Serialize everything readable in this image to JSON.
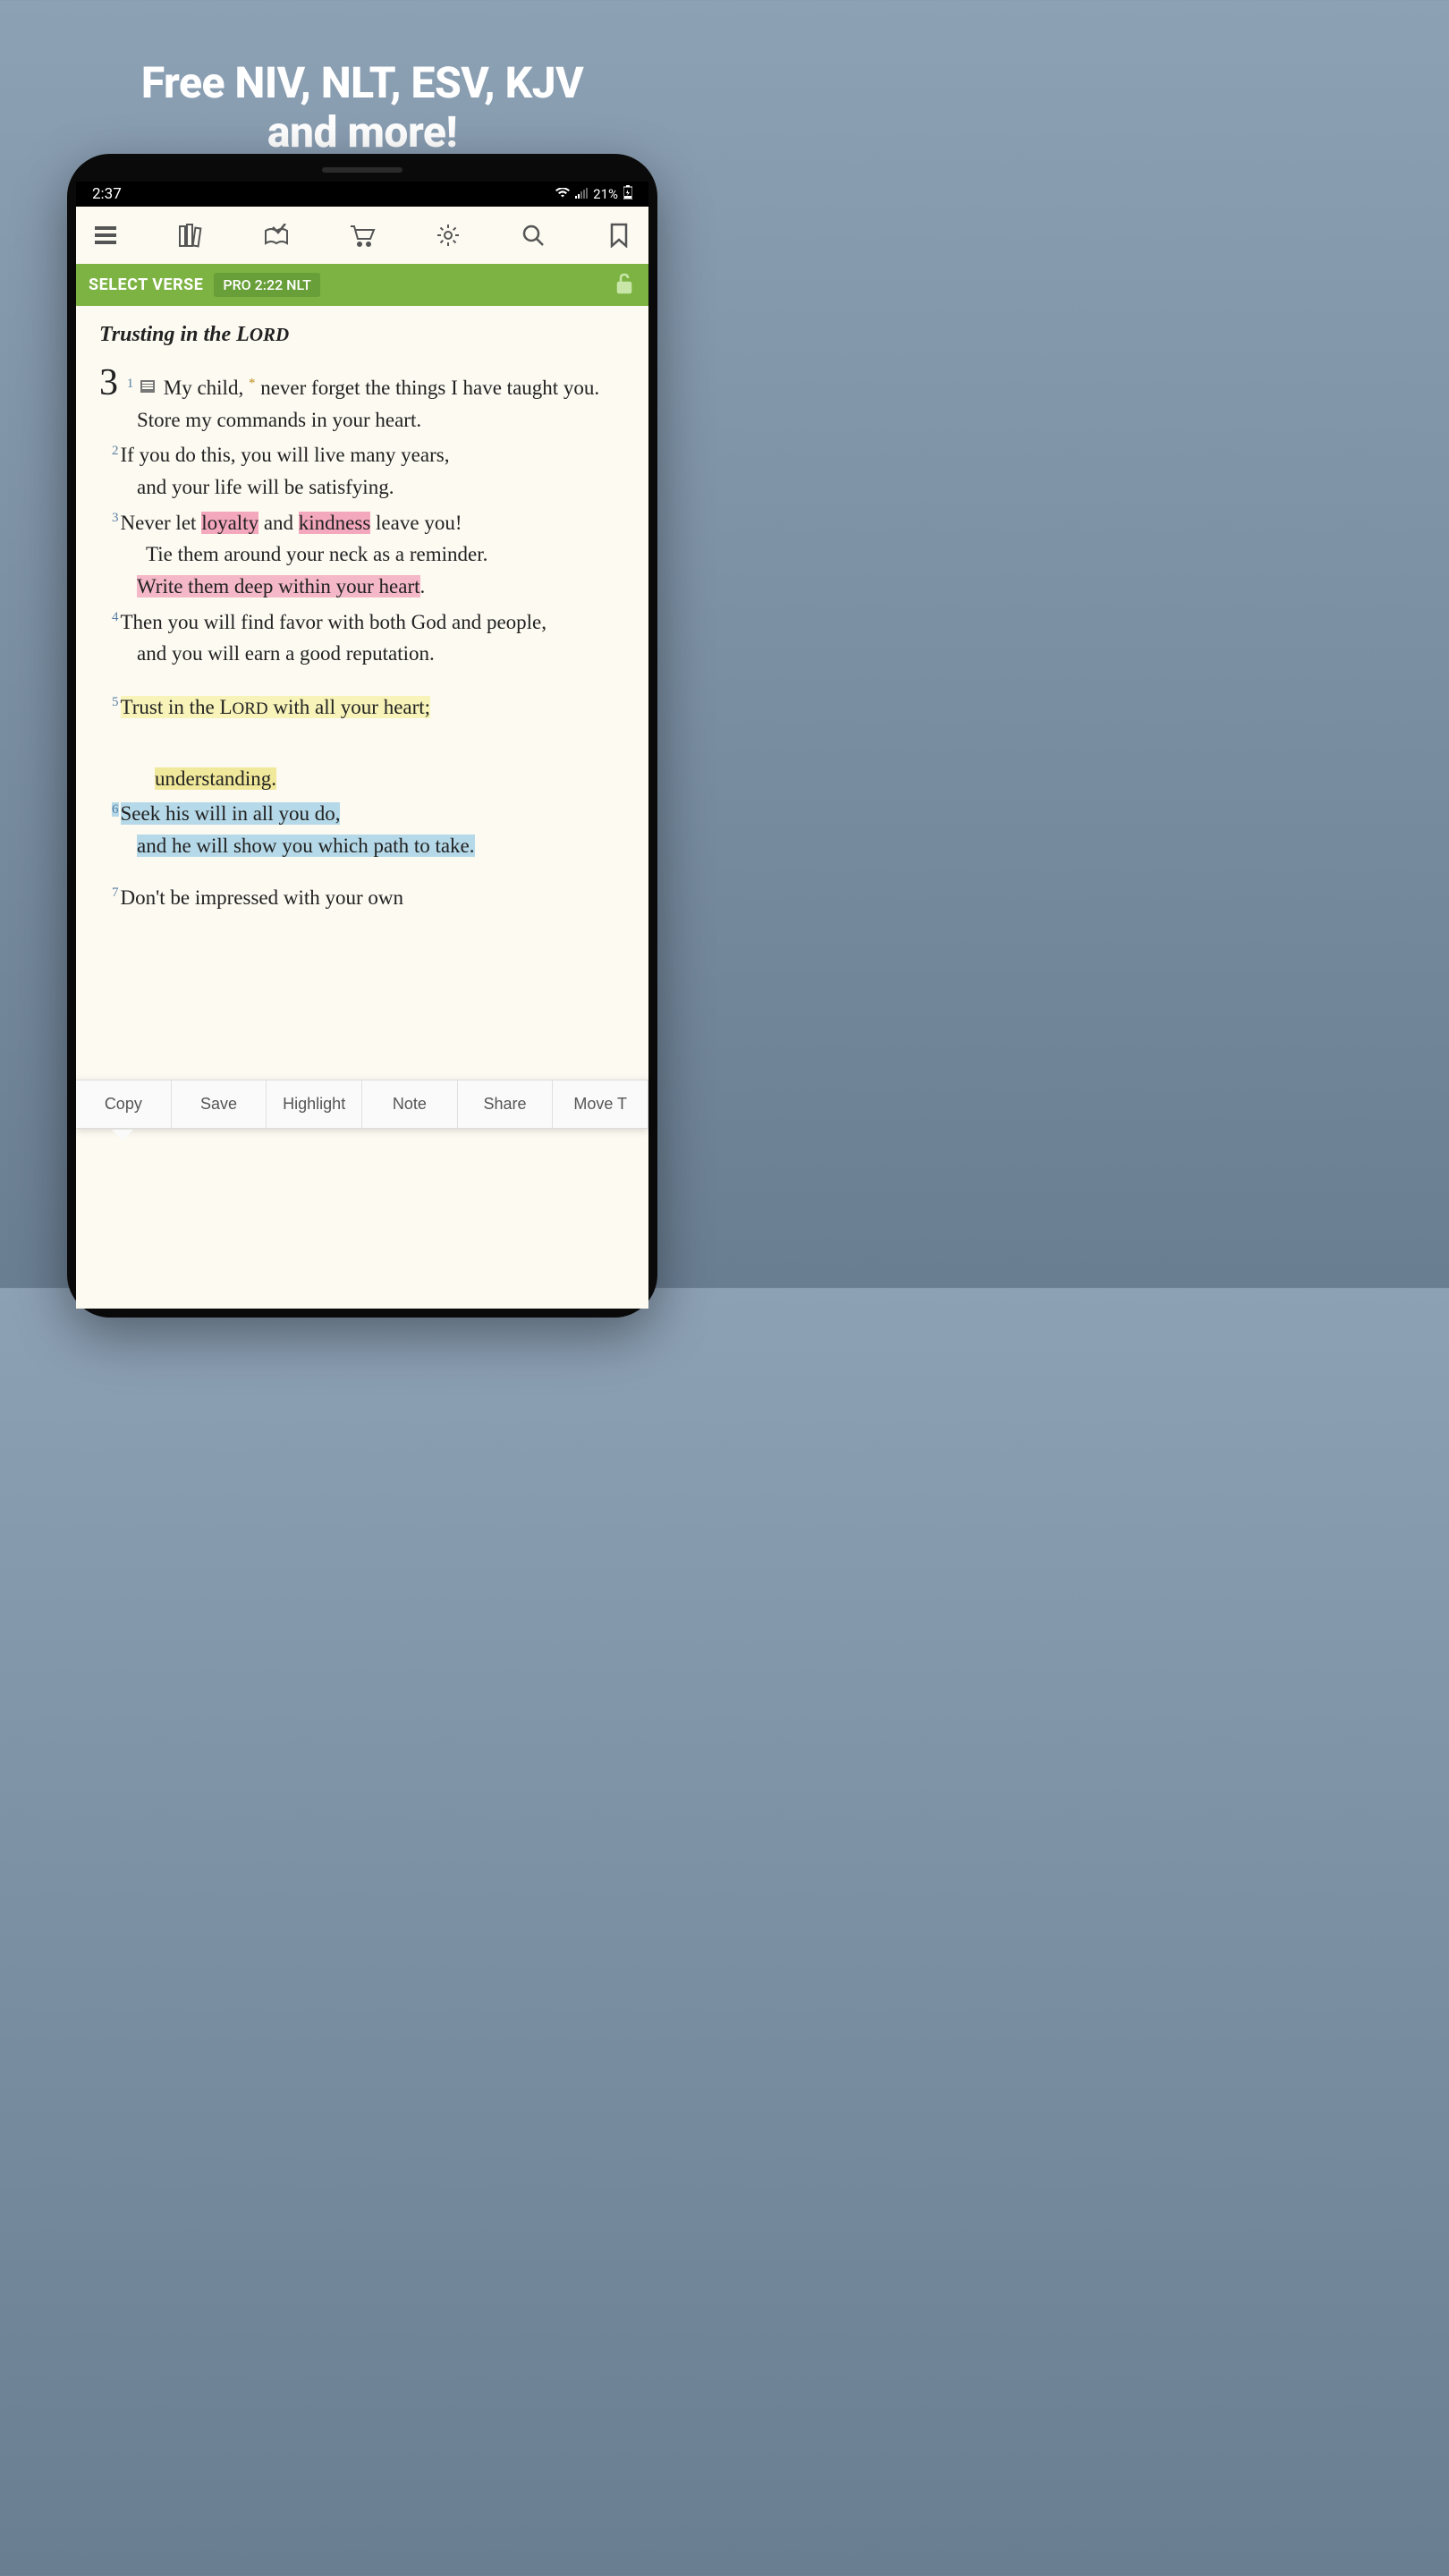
{
  "promo": {
    "title_line1": "Free NIV, NLT, ESV, KJV",
    "title_line2": "and more!"
  },
  "status": {
    "time": "2:37",
    "battery": "21%"
  },
  "verse_bar": {
    "select_label": "SELECT VERSE",
    "reference": "PRO 2:22 NLT"
  },
  "chapter": {
    "heading_prefix": "Trusting in the L",
    "heading_suffix": "ORD",
    "number": "3"
  },
  "verses": {
    "v1_num": "1",
    "v1_a": "My child,",
    "v1_b": " never forget the things I have taught you.",
    "v1_c": "Store my commands in your heart.",
    "v2_num": "2",
    "v2_a": "If you do this, you will live many years,",
    "v2_b": "and your life will be satisfying.",
    "v3_num": "3",
    "v3_a": "Never let ",
    "v3_loyalty": "loyalty",
    "v3_and": " and ",
    "v3_kindness": "kindness",
    "v3_b": " leave you!",
    "v3_c": "Tie them around your neck as a reminder.",
    "v3_d": "Write them deep within your heart",
    "v3_period": ".",
    "v4_num": "4",
    "v4_a": "Then you will find favor with both God and people,",
    "v4_b": "and you will earn a good reputation.",
    "v5_num": "5",
    "v5_a": "Trust in the L",
    "v5_ord": "ORD",
    "v5_b": " with all your heart;",
    "v5_c": "understanding.",
    "v6_num": "6",
    "v6_a": "Seek his will in all you do,",
    "v6_b": "and he will show you which path to take.",
    "v7_num": "7",
    "v7_a": "Don't be impressed with your own"
  },
  "actions": {
    "copy": "Copy",
    "save": "Save",
    "highlight": "Highlight",
    "note": "Note",
    "share": "Share",
    "move": "Move T"
  }
}
